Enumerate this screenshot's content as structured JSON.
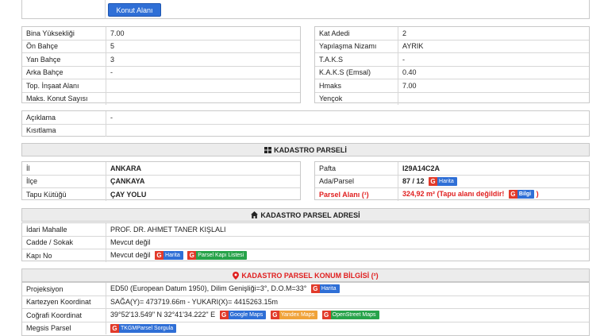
{
  "top": {
    "button_label": "Konut Alanı"
  },
  "zoning_left": [
    {
      "label": "Bina Yüksekliği",
      "value": "7.00"
    },
    {
      "label": "Ön Bahçe",
      "value": "5"
    },
    {
      "label": "Yan Bahçe",
      "value": "3"
    },
    {
      "label": "Arka Bahçe",
      "value": "-"
    },
    {
      "label": "Top. İnşaat Alanı",
      "value": ""
    },
    {
      "label": "Maks. Konut Sayısı",
      "value": ""
    }
  ],
  "zoning_right": [
    {
      "label": "Kat Adedi",
      "value": "2"
    },
    {
      "label": "Yapılaşma Nizamı",
      "value": "AYRIK"
    },
    {
      "label": "T.A.K.S",
      "value": "-"
    },
    {
      "label": "K.A.K.S (Emsal)",
      "value": "0.40"
    },
    {
      "label": "Hmaks",
      "value": "7.00"
    },
    {
      "label": "Yençok",
      "value": ""
    }
  ],
  "notes": [
    {
      "label": "Açıklama",
      "value": "-"
    },
    {
      "label": "Kısıtlama",
      "value": ""
    }
  ],
  "kadastro": {
    "title": "KADASTRO PARSELİ",
    "left": [
      {
        "label": "İl",
        "value": "ANKARA"
      },
      {
        "label": "İlçe",
        "value": "ÇANKAYA"
      },
      {
        "label": "Tapu Kütüğü",
        "value": "ÇAY YOLU"
      }
    ],
    "pafta_label": "Pafta",
    "pafta_value": "I29A14C2A",
    "ada_label": "Ada/Parsel",
    "ada_value": "87 / 12",
    "harita_label": "Harita",
    "alan_label": "Parsel Alanı (¹)",
    "alan_value": "324,92 m²",
    "alan_note_open": "(Tapu alanı değildir!",
    "bilgi_label": "Bilgi",
    "alan_note_close": ")"
  },
  "adres": {
    "title": "KADASTRO PARSEL ADRESİ",
    "rows": [
      {
        "label": "İdari Mahalle",
        "value": "PROF. DR. AHMET TANER KIŞLALI"
      },
      {
        "label": "Cadde / Sokak",
        "value": "Mevcut değil"
      }
    ],
    "kapi_label": "Kapı No",
    "kapi_value": "Mevcut değil",
    "harita_label": "Harita",
    "liste_label": "Parsel Kapı Listesi"
  },
  "konum": {
    "title": "KADASTRO PARSEL KONUM BİLGİSİ (²)",
    "projeksiyon_label": "Projeksiyon",
    "projeksiyon_value": "ED50 (European Datum 1950), Dilim Genişliği=3°, D.O.M=33°",
    "harita_label": "Harita",
    "kartezyen_label": "Kartezyen Koordinat",
    "kartezyen_value": "SAĞA(Y)= 473719.66m - YUKARI(X)= 4415263.15m",
    "cografi_label": "Coğrafi Koordinat",
    "cografi_value": "39°52'13.549\" N 32°41'34.222\" E",
    "google_label": "Google Maps",
    "yandex_label": "Yandex Maps",
    "osm_label": "OpenStreet Maps",
    "megsis_label": "Megsis Parsel",
    "tkgm_label": "TKGMParsel Sorgula"
  }
}
